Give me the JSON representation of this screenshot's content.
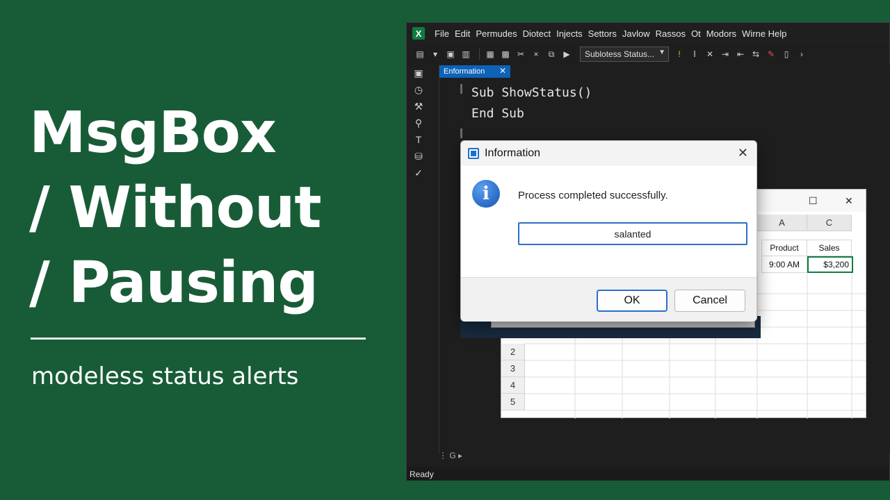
{
  "headline": {
    "line1": "MsgBox",
    "line2": "/ Without",
    "line3": "/ Pausing"
  },
  "subtitle": "modeless status alerts",
  "menubar": {
    "items": [
      "File",
      "Edit",
      "Permudes",
      "Diotect",
      "Injects",
      "Settors",
      "Javlow",
      "Rassos",
      "Ot",
      "Modors",
      "Wirne Help"
    ]
  },
  "toolbar": {
    "combo_value": "Sublotess Status..."
  },
  "tab": {
    "label": "Enformation"
  },
  "code": {
    "line1": "Sub ShowStatus()",
    "line2": "End Sub"
  },
  "dialog": {
    "title": "Information",
    "message": "Process completed successfully.",
    "input_value": "salanted",
    "ok_label": "OK",
    "cancel_label": "Cancel"
  },
  "sheet": {
    "columns": [
      "A",
      "C"
    ],
    "header_row": [
      "Product",
      "Sales"
    ],
    "data_row": [
      "9:00 AM",
      "$3,200"
    ],
    "row_numbers": [
      "2",
      "3",
      "4",
      "5"
    ]
  },
  "status": {
    "text": "Ready"
  },
  "bottom": {
    "text": "G"
  }
}
